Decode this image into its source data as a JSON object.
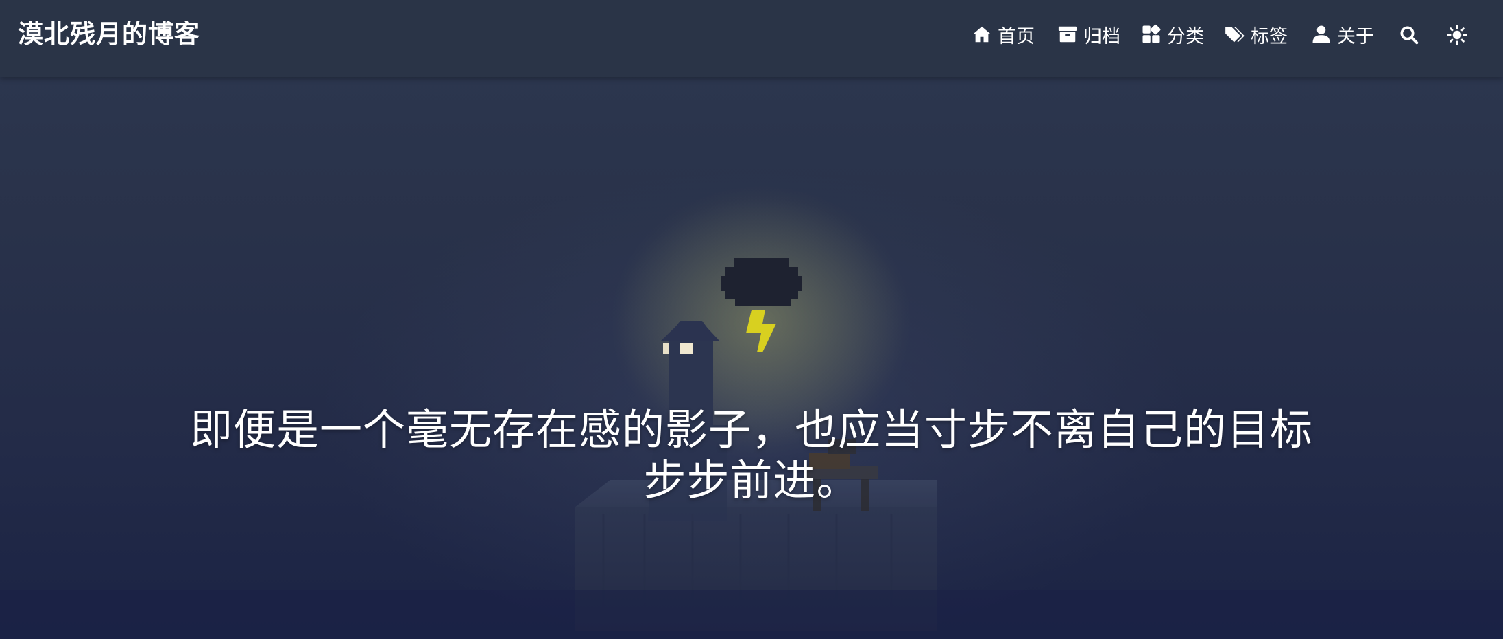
{
  "site": {
    "title": "漠北残月的博客"
  },
  "nav": {
    "items": [
      {
        "label": "首页",
        "icon": "home-icon"
      },
      {
        "label": "归档",
        "icon": "archive-icon"
      },
      {
        "label": "分类",
        "icon": "category-icon"
      },
      {
        "label": "标签",
        "icon": "tags-icon"
      },
      {
        "label": "关于",
        "icon": "user-icon"
      }
    ],
    "search_icon": "search-icon",
    "theme_icon": "sun-icon"
  },
  "hero": {
    "slogan_line1": "即便是一个毫无存在感的影子，也应当寸步不离自己的目标",
    "slogan_line2": "步步前进。"
  },
  "colors": {
    "navbar_bg": "#2a3447",
    "hero_bg_top": "#2d3850",
    "hero_bg_bottom": "#1b2344",
    "lightning": "#d8d020"
  }
}
